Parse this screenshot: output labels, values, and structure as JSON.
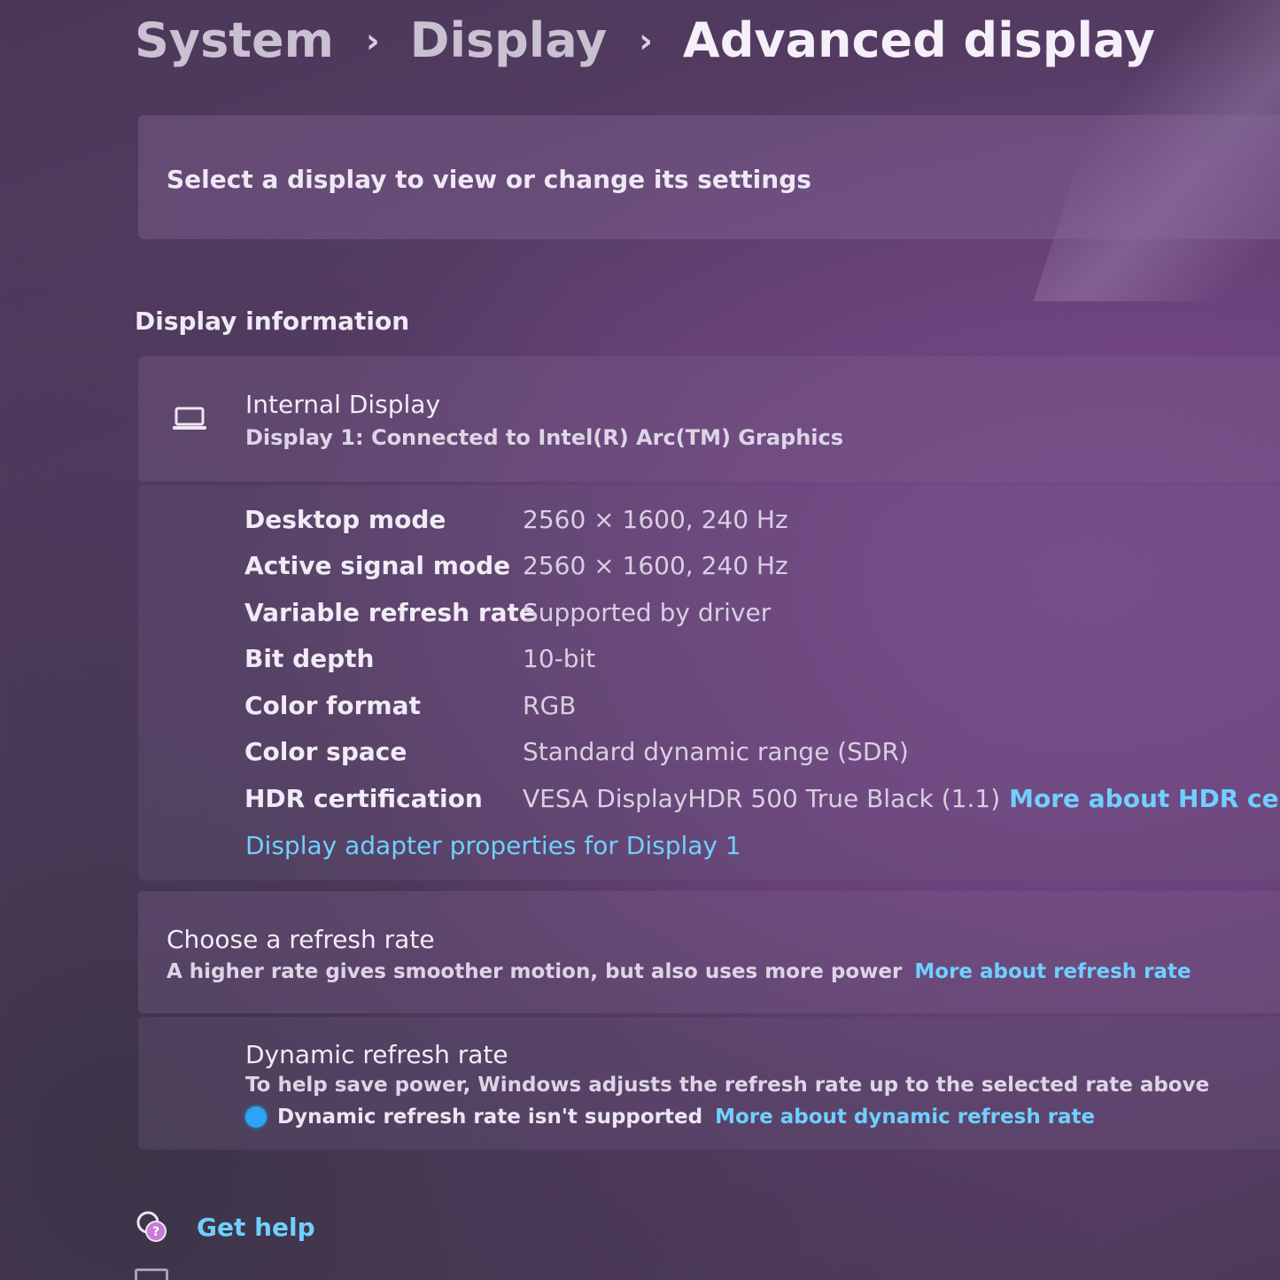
{
  "breadcrumb": {
    "items": [
      "System",
      "Display",
      "Advanced display"
    ],
    "separator": "›"
  },
  "select_display": {
    "text": "Select a display to view or change its settings"
  },
  "display_information": {
    "section_title": "Display information",
    "icon": "laptop-icon",
    "display_name": "Internal Display",
    "connection": "Display 1: Connected to Intel(R) Arc(TM) Graphics",
    "rows": [
      {
        "label": "Desktop mode",
        "value": "2560 × 1600, 240 Hz"
      },
      {
        "label": "Active signal mode",
        "value": "2560 × 1600, 240 Hz"
      },
      {
        "label": "Variable refresh rate",
        "value": "Supported by driver"
      },
      {
        "label": "Bit depth",
        "value": "10-bit"
      },
      {
        "label": "Color format",
        "value": "RGB"
      },
      {
        "label": "Color space",
        "value": "Standard dynamic range (SDR)"
      },
      {
        "label": "HDR certification",
        "value": "VESA DisplayHDR 500 True Black (1.1)",
        "link": "More about HDR certificatio"
      }
    ],
    "adapter_link": "Display adapter properties for Display 1"
  },
  "refresh_rate": {
    "title": "Choose a refresh rate",
    "subtitle": "A higher rate gives smoother motion, but also uses more power",
    "link": "More about refresh rate"
  },
  "dynamic_refresh": {
    "title": "Dynamic refresh rate",
    "subtitle": "To help save power, Windows adjusts the refresh rate up to the selected rate above",
    "status_icon": "info-icon",
    "status": "Dynamic refresh rate isn't supported",
    "link": "More about dynamic refresh rate"
  },
  "footer": {
    "help_icon": "help-chat-icon",
    "help_label": "Get help"
  },
  "colors": {
    "link": "#6fd0ff",
    "info_dot": "#2aa4f4"
  }
}
